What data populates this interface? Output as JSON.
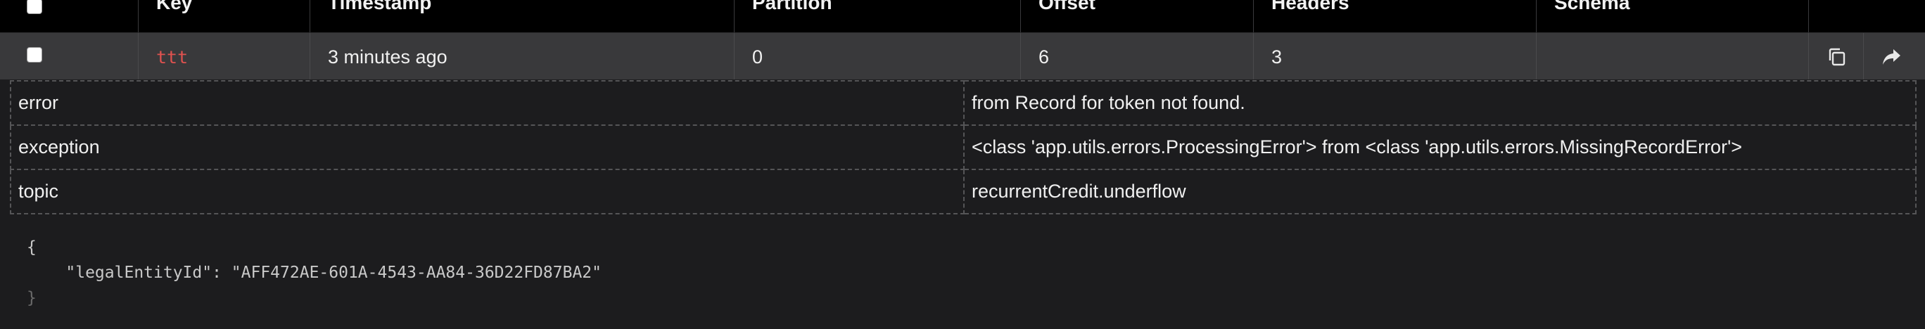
{
  "table": {
    "columns": [
      "Key",
      "Timestamp",
      "Partition",
      "Offset",
      "Headers",
      "Schema"
    ]
  },
  "message": {
    "key": "ttt",
    "timestamp": "3 minutes ago",
    "partition": "0",
    "offset": "6",
    "headers_count": "3",
    "schema": ""
  },
  "headers": [
    {
      "name": "error",
      "value": "from Record for token not found."
    },
    {
      "name": "exception",
      "value": "<class 'app.utils.errors.ProcessingError'> from <class 'app.utils.errors.MissingRecordError'>"
    },
    {
      "name": "topic",
      "value": "recurrentCredit.underflow"
    }
  ],
  "payload": {
    "open": "{",
    "line": "    \"legalEntityId\": \"AFF472AE-601A-4543-AA84-36D22FD87BA2\"",
    "close": "}"
  },
  "icons": {
    "copy": "copy-icon",
    "share": "share-icon"
  },
  "colors": {
    "key_text": "#e0524f",
    "header_bg": "#000000",
    "row_bg": "#39393b",
    "page_bg": "#1c1c1e"
  }
}
